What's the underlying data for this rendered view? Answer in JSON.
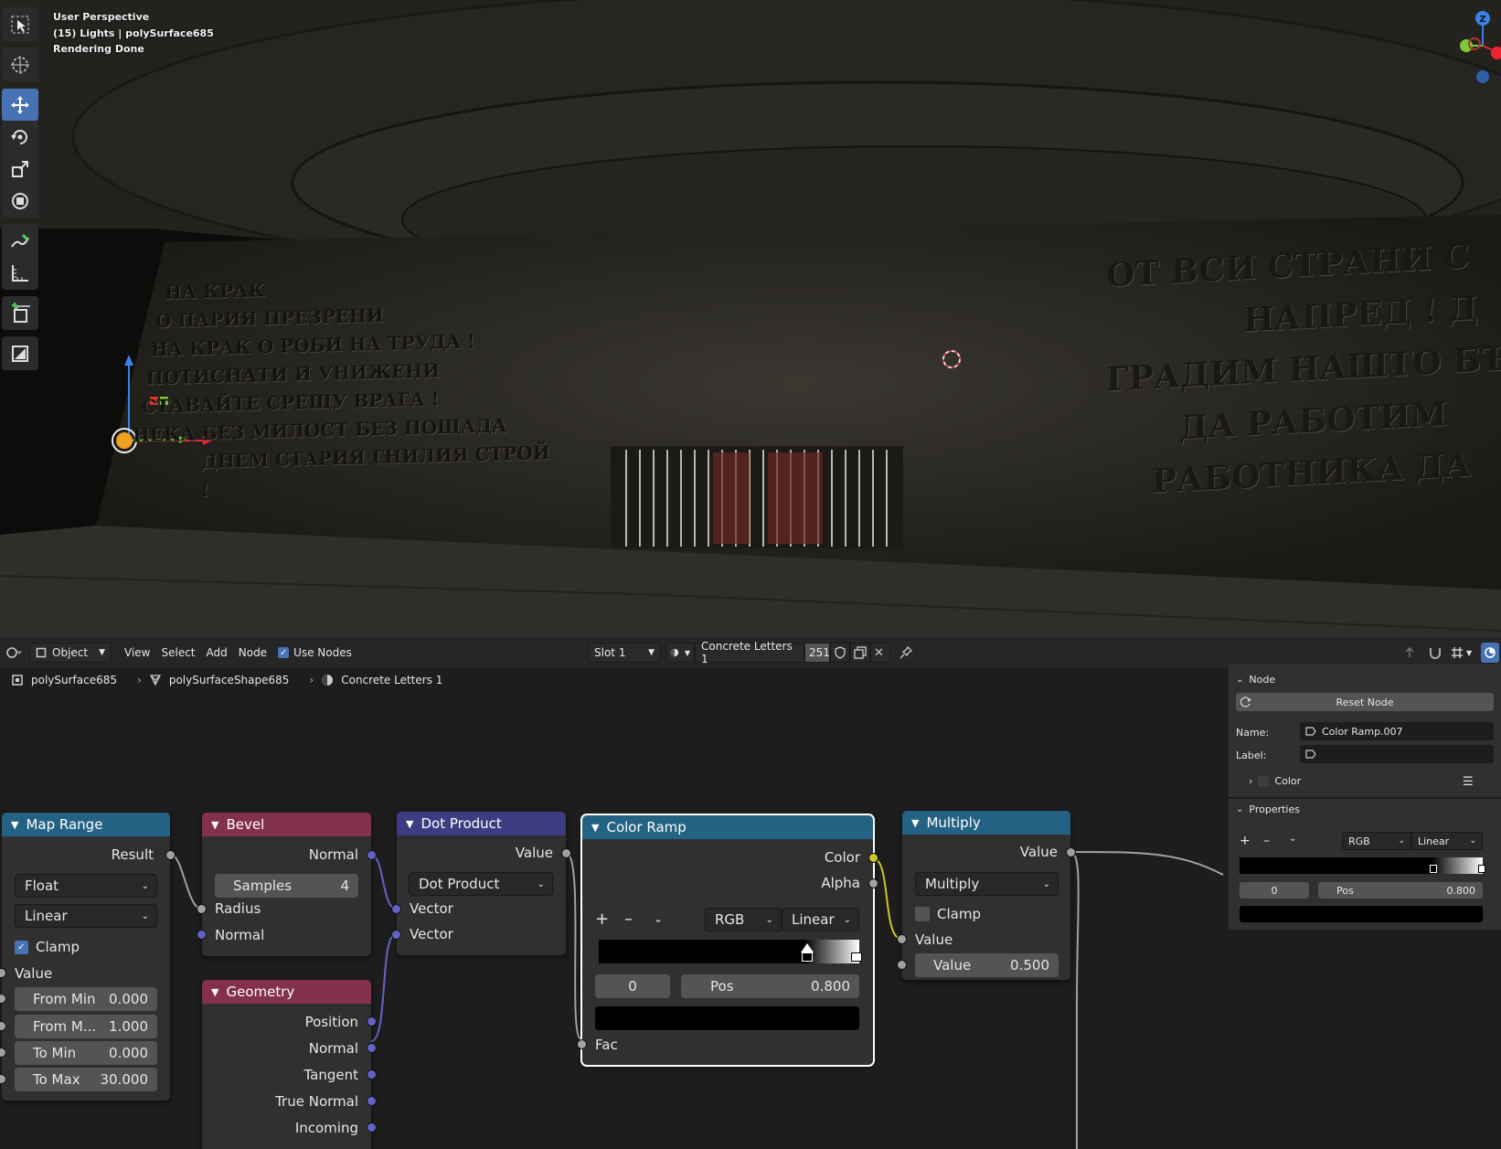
{
  "viewport": {
    "hud": {
      "line1": "User Perspective",
      "line2": "(15) Lights | polySurface685",
      "line3": "Rendering Done"
    },
    "gizmo": {
      "z_axis_label": "Z"
    },
    "scene_text_left": [
      "НА КРАК",
      "О ПАРИЯ ПРЕЗРЕНИ",
      "НА КРАК О РОБИ НА ТРУДА !",
      "ПОТИСНАТИ И УНИЖЕНИ",
      "СТАВАЙТЕ СРЕЩУ ВРАГА !",
      "НЕКА БЕЗ МИЛОСТ БЕЗ ПОЩАДА",
      "ДНЕМ СТАРИЯ ГНИЛИЯ СТРОЙ !"
    ],
    "scene_text_right": [
      "ОТ ВСИ СТРАНИ С",
      "НАПРЕД ! Д",
      "ГРАДИМ НАШТО БЪ",
      "ДА РАБОТИМ",
      "РАБОТНИКА ДА"
    ]
  },
  "header": {
    "mode": "Object",
    "menus": [
      "View",
      "Select",
      "Add",
      "Node"
    ],
    "use_nodes_label": "Use Nodes",
    "slot": "Slot 1",
    "material": "Concrete Letters 1",
    "users": "251"
  },
  "breadcrumb": {
    "object": "polySurface685",
    "mesh": "polySurfaceShape685",
    "material": "Concrete Letters 1"
  },
  "nodes": {
    "map_range": {
      "title": "Map Range",
      "result": "Result",
      "data_type": "Float",
      "interp": "Linear",
      "clamp": "Clamp",
      "value": "Value",
      "fields": [
        {
          "label": "From Min",
          "value": "0.000"
        },
        {
          "label": "From M...",
          "value": "1.000"
        },
        {
          "label": "To Min",
          "value": "0.000"
        },
        {
          "label": "To Max",
          "value": "30.000"
        }
      ]
    },
    "bevel": {
      "title": "Bevel",
      "out_normal": "Normal",
      "samples_label": "Samples",
      "samples_value": "4",
      "radius": "Radius",
      "in_normal": "Normal"
    },
    "geometry": {
      "title": "Geometry",
      "outputs": [
        "Position",
        "Normal",
        "Tangent",
        "True Normal",
        "Incoming"
      ]
    },
    "dot_product": {
      "title": "Dot Product",
      "value": "Value",
      "op": "Dot Product",
      "vec1": "Vector",
      "vec2": "Vector"
    },
    "color_ramp": {
      "title": "Color Ramp",
      "color": "Color",
      "alpha": "Alpha",
      "mode": "RGB",
      "interp": "Linear",
      "index": "0",
      "pos_label": "Pos",
      "pos_value": "0.800",
      "fac": "Fac"
    },
    "multiply": {
      "title": "Multiply",
      "value_out": "Value",
      "op": "Multiply",
      "clamp": "Clamp",
      "value_in": "Value",
      "field_label": "Value",
      "field_value": "0.500"
    }
  },
  "side_panel": {
    "node_section": "Node",
    "reset": "Reset Node",
    "name_label": "Name:",
    "name_value": "Color Ramp.007",
    "label_label": "Label:",
    "color_sub": "Color",
    "properties_section": "Properties",
    "mode": "RGB",
    "interp": "Linear",
    "index": "0",
    "pos_label": "Pos",
    "pos_value": "0.800"
  },
  "colors": {
    "accent": "#4772b3",
    "map_range_header": "#246283",
    "bevel_header": "#83314a",
    "geometry_header": "#83314a",
    "dot_product_header": "#3c3c83",
    "color_ramp_header": "#246283",
    "multiply_header": "#246283",
    "socket_float": "#a1a1a1",
    "socket_vector": "#6363c7",
    "socket_color": "#c7c729"
  }
}
